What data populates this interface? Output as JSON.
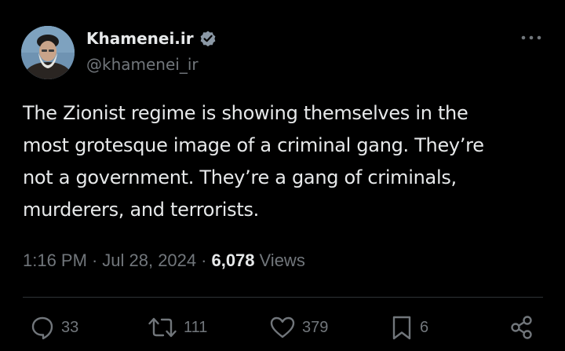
{
  "tweet": {
    "author": {
      "display_name": "Khamenei.ir",
      "handle": "@khamenei_ir",
      "verified": true
    },
    "text": "The Zionist regime is showing themselves in the\nmost grotesque image of a criminal gang. They’re\nnot a government. They’re a gang of criminals,\nmurderers, and terrorists.",
    "time": "1:16 PM",
    "separator": "·",
    "date": "Jul 28, 2024",
    "views_count": "6,078",
    "views_label": "Views",
    "actions": {
      "replies": "33",
      "reposts": "111",
      "likes": "379",
      "bookmarks": "6"
    }
  },
  "icons": {
    "more": "more-horizontal-icon",
    "verified": "verified-badge-icon",
    "reply": "reply-icon",
    "repost": "repost-icon",
    "like": "heart-icon",
    "bookmark": "bookmark-icon",
    "share": "share-icon"
  },
  "colors": {
    "background": "#000000",
    "primary_text": "#e7e9ea",
    "secondary_text": "#71767b",
    "divider": "#2f3336"
  }
}
